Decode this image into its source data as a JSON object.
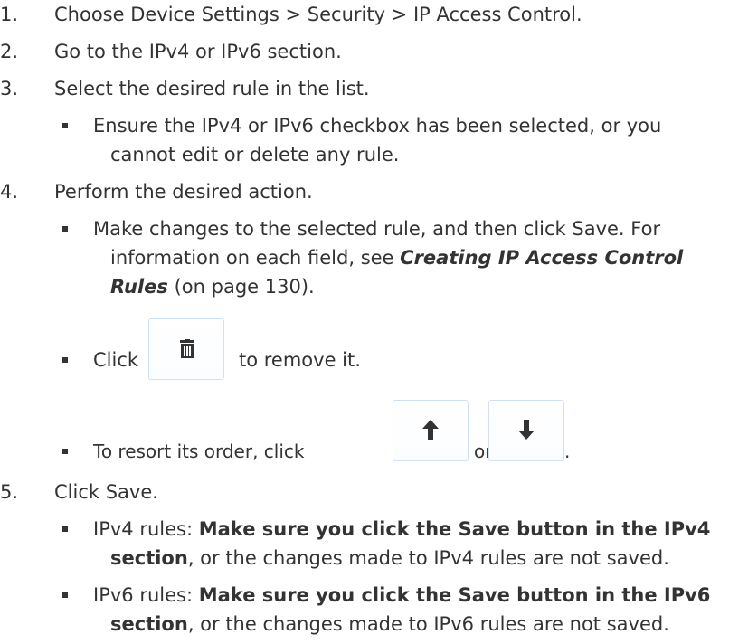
{
  "steps": [
    {
      "number": "1.",
      "text": "Choose Device Settings > Security > IP Access Control."
    },
    {
      "number": "2.",
      "text": "Go to the IPv4 or IPv6 section."
    },
    {
      "number": "3.",
      "text": "Select the desired rule in the list."
    },
    {
      "number": "4.",
      "text": "Perform the desired action."
    },
    {
      "number": "5.",
      "text": "Click Save."
    }
  ],
  "step3_note": {
    "line1": "Ensure the IPv4 or IPv6 checkbox has been selected, or you",
    "line2": "cannot edit or delete any rule."
  },
  "step4_actions": {
    "edit_line1": "Make changes to the selected rule, and then click Save. For",
    "edit_line2_prefix": "information on each field, see ",
    "edit_xref_line2": "Creating IP Access Control",
    "edit_xref_line3": "Rules",
    "edit_line3_suffix": " (on page 130).",
    "delete_prefix": "Click",
    "delete_suffix": "to remove it.",
    "resort_prefix": "To resort its order, click",
    "resort_or": "or",
    "resort_suffix": "."
  },
  "step5_notes": {
    "ipv4_label": "IPv4 rules: ",
    "ipv4_bold_line1": "Make sure you click the Save button in the IPv4",
    "ipv4_bold_line2": "section",
    "ipv4_rest_line2": ", or the changes made to IPv4 rules are not saved.",
    "ipv6_label": "IPv6 rules: ",
    "ipv6_bold_line1": "Make sure you click the Save button in the IPv6",
    "ipv6_bold_line2": "section",
    "ipv6_rest_line2": ", or the changes made to IPv6 rules are not saved."
  },
  "icons": {
    "delete": "trash-icon",
    "move_up": "arrow-up-icon",
    "move_down": "arrow-down-icon"
  },
  "colors": {
    "text": "#333333",
    "button_border": "#cfe2f3",
    "icon": "#333333"
  }
}
